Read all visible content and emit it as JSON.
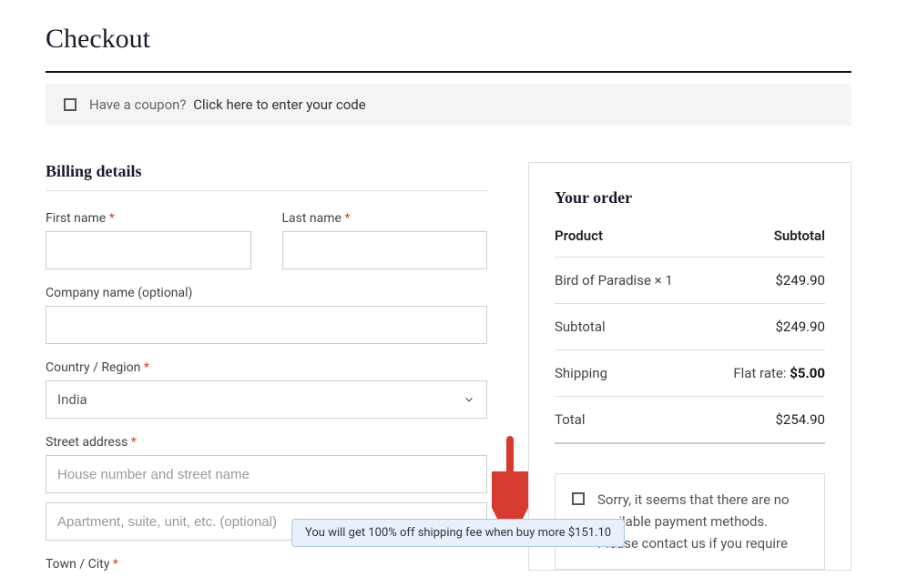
{
  "title": "Checkout",
  "coupon": {
    "prompt": "Have a coupon?",
    "link": "Click here to enter your code"
  },
  "billing": {
    "heading": "Billing details",
    "first_name_label": "First name",
    "last_name_label": "Last name",
    "company_label": "Company name (optional)",
    "country_label": "Country / Region",
    "country_value": "India",
    "street_label": "Street address",
    "street_placeholder1": "House number and street name",
    "street_placeholder2": "Apartment, suite, unit, etc. (optional)",
    "town_label": "Town / City"
  },
  "order": {
    "heading": "Your order",
    "col_product": "Product",
    "col_subtotal": "Subtotal",
    "item_name": "Bird of Paradise × 1",
    "item_price": "$249.90",
    "subtotal_label": "Subtotal",
    "subtotal_value": "$249.90",
    "shipping_label": "Shipping",
    "shipping_prefix": "Flat rate:",
    "shipping_value": "$5.00",
    "total_label": "Total",
    "total_value": "$254.90",
    "payment_msg": "Sorry, it seems that there are no available payment methods. Please contact us if you require"
  },
  "tooltip": "You will get 100% off shipping fee when buy more $151.10",
  "required": "*"
}
